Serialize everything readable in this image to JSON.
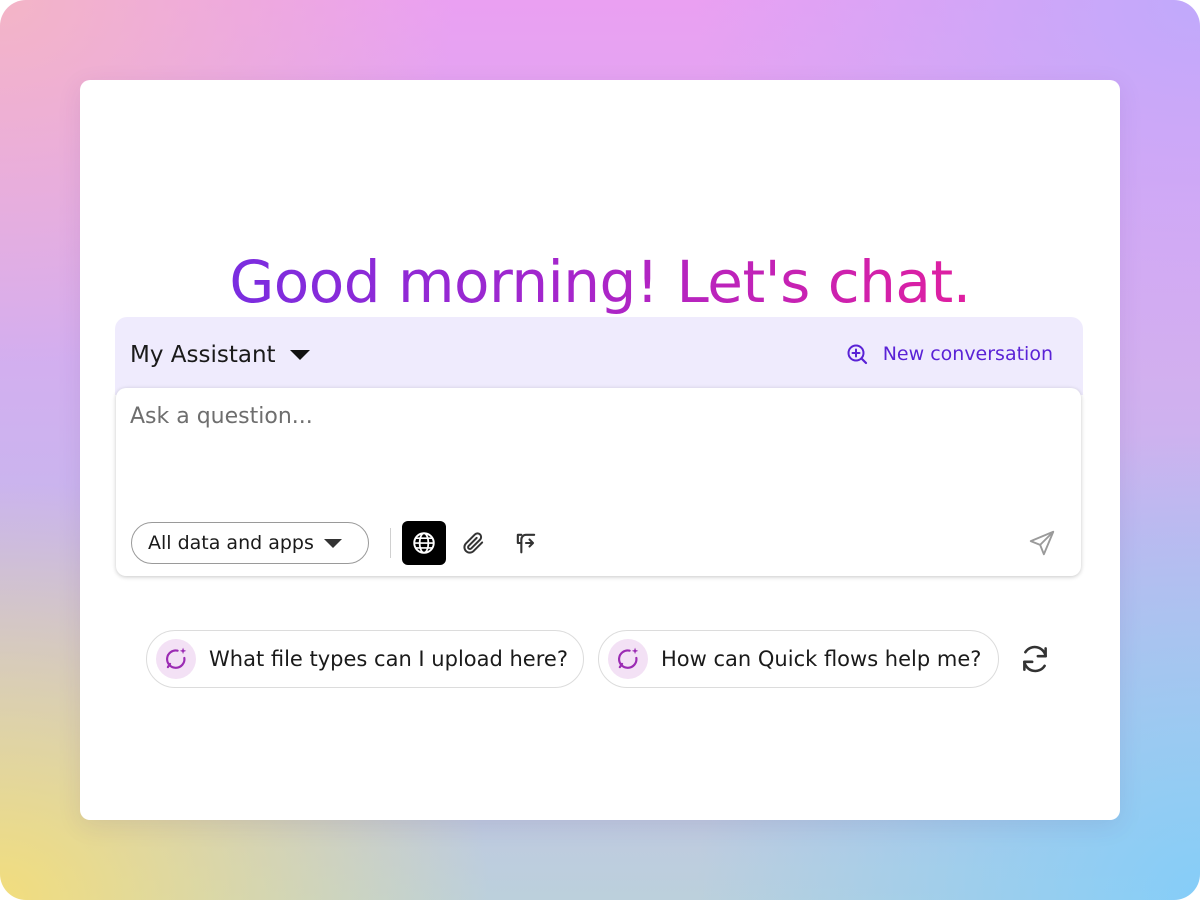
{
  "greeting": "Good morning! Let's chat.",
  "assistant": {
    "name": "My Assistant",
    "new_conversation_label": "New conversation"
  },
  "composer": {
    "placeholder": "Ask a question...",
    "scope_selected": "All data and apps",
    "tools": [
      "globe-icon",
      "paperclip-icon",
      "flow-icon",
      "send-icon"
    ]
  },
  "suggestions": [
    {
      "label": "What file types can I upload here?",
      "icon": "sparkle-chat-icon"
    },
    {
      "label": "How can Quick flows help me?",
      "icon": "sparkle-chat-icon"
    }
  ],
  "colors": {
    "accent": "#5a22d6",
    "greeting_gradient_start": "#7a2de0",
    "greeting_gradient_end": "#e01fa0",
    "panel_bg": "#efebfd",
    "badge_bg": "#f3e1f5",
    "sparkle": "#9b2bb3"
  }
}
